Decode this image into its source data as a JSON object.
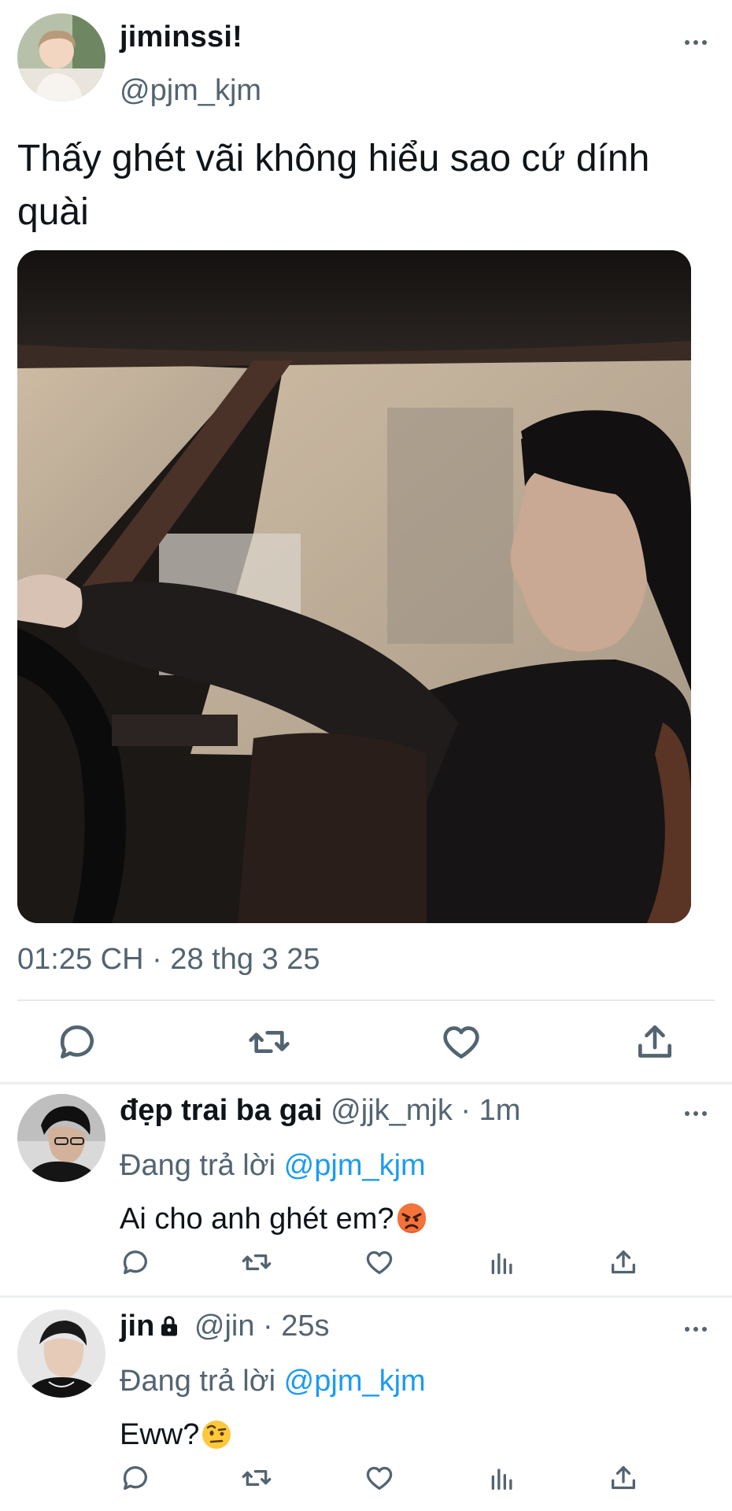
{
  "main_tweet": {
    "display_name": "jiminssi!",
    "handle": "@pjm_kjm",
    "text": "Thấy ghét vãi không hiểu sao cứ dính quài",
    "timestamp": "01:25 CH · 28 thg 3 25",
    "actions": [
      "reply-icon",
      "retweet-icon",
      "like-icon",
      "share-icon"
    ]
  },
  "replies": [
    {
      "display_name": "đẹp trai ba gai",
      "meta": " @jjk_mjk · 1m",
      "replying_prefix": "Đang trả lời ",
      "replying_to": "@pjm_kjm",
      "text": "Ai cho anh ghét em?",
      "emoji": "angry-face-emoji",
      "locked": false
    },
    {
      "display_name": "jin",
      "meta": " @jin · 25s",
      "replying_prefix": "Đang trả lời ",
      "replying_to": "@pjm_kjm",
      "text": "Eww?",
      "emoji": "raised-eyebrow-emoji",
      "locked": true
    }
  ],
  "colors": {
    "text_primary": "#0f1419",
    "text_secondary": "#536471",
    "link": "#1d9bf0",
    "divider": "#eceef0"
  }
}
